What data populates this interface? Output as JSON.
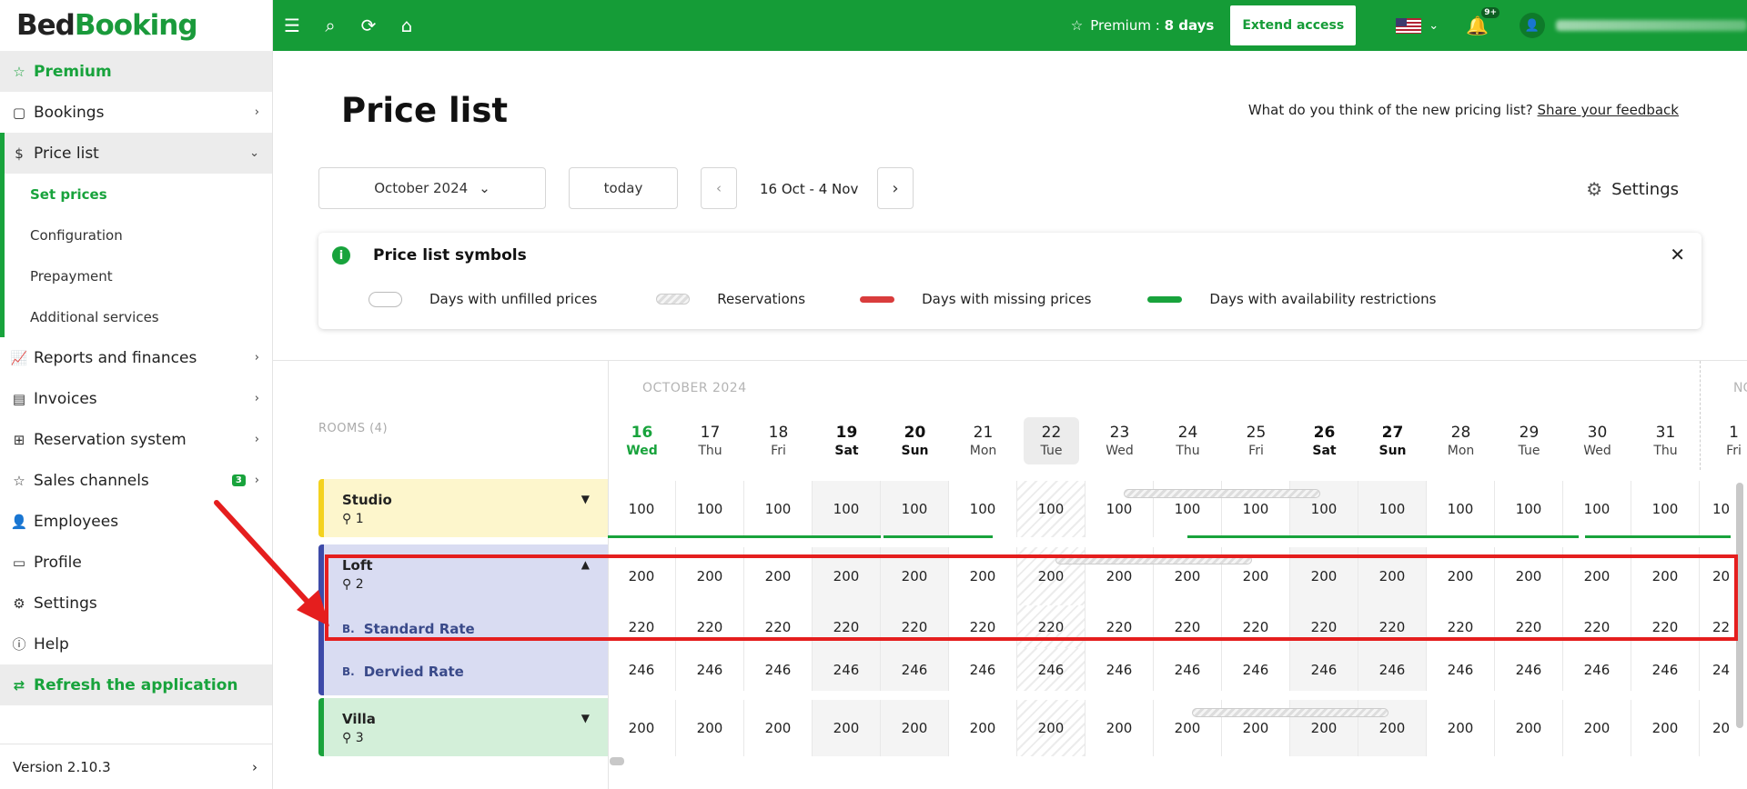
{
  "logo": {
    "part1": "Bed",
    "part2": "Booking"
  },
  "sidebar": {
    "premium": "Premium",
    "items": [
      {
        "label": "Bookings"
      },
      {
        "label": "Price list"
      },
      {
        "label": "Reports and finances"
      },
      {
        "label": "Invoices"
      },
      {
        "label": "Reservation system"
      },
      {
        "label": "Sales channels",
        "badge": "3"
      },
      {
        "label": "Employees"
      },
      {
        "label": "Profile"
      },
      {
        "label": "Settings"
      },
      {
        "label": "Help"
      }
    ],
    "sub_items": [
      "Set prices",
      "Configuration",
      "Prepayment",
      "Additional services"
    ],
    "refresh": "Refresh the application",
    "version": "Version 2.10.3"
  },
  "topbar": {
    "premium_prefix": "Premium : ",
    "premium_days": "8 days",
    "extend": "Extend access",
    "notif_count": "9+"
  },
  "page": {
    "title": "Price list",
    "feedback_q": "What do you think of the new pricing list?",
    "feedback_link": "Share your feedback",
    "month_select": "October 2024",
    "today": "today",
    "range": "16 Oct - 4 Nov",
    "settings": "Settings"
  },
  "symbols": {
    "title": "Price list symbols",
    "unfilled": "Days with unfilled prices",
    "reservations": "Reservations",
    "missing": "Days with missing prices",
    "availability": "Days with availability restrictions"
  },
  "grid": {
    "rooms_header": "ROOMS (4)",
    "month": "OCTOBER 2024",
    "next_month": "NO",
    "days": [
      {
        "n": "16",
        "d": "Wed"
      },
      {
        "n": "17",
        "d": "Thu"
      },
      {
        "n": "18",
        "d": "Fri"
      },
      {
        "n": "19",
        "d": "Sat"
      },
      {
        "n": "20",
        "d": "Sun"
      },
      {
        "n": "21",
        "d": "Mon"
      },
      {
        "n": "22",
        "d": "Tue"
      },
      {
        "n": "23",
        "d": "Wed"
      },
      {
        "n": "24",
        "d": "Thu"
      },
      {
        "n": "25",
        "d": "Fri"
      },
      {
        "n": "26",
        "d": "Sat"
      },
      {
        "n": "27",
        "d": "Sun"
      },
      {
        "n": "28",
        "d": "Mon"
      },
      {
        "n": "29",
        "d": "Tue"
      },
      {
        "n": "30",
        "d": "Wed"
      },
      {
        "n": "31",
        "d": "Thu"
      },
      {
        "n": "1",
        "d": "Fri"
      }
    ],
    "rooms": [
      {
        "name": "Studio",
        "capacity": "1",
        "price": "100",
        "color": "#f4d21f",
        "bg": "#fdf6cc"
      },
      {
        "name": "Loft",
        "capacity": "2",
        "price": "200",
        "color": "#3d4aa8",
        "bg": "#d9dcf2",
        "rates": [
          {
            "name": "Standard Rate",
            "price": "220"
          },
          {
            "name": "Dervied Rate",
            "price": "246"
          }
        ]
      },
      {
        "name": "Villa",
        "capacity": "3",
        "price": "200",
        "color": "#1aa33c",
        "bg": "#d3efd9"
      }
    ],
    "last_col_partial": [
      "10",
      "20",
      "22",
      "24",
      "20"
    ]
  },
  "colors": {
    "brand": "#159c37",
    "highlight": "#e51e1e"
  }
}
